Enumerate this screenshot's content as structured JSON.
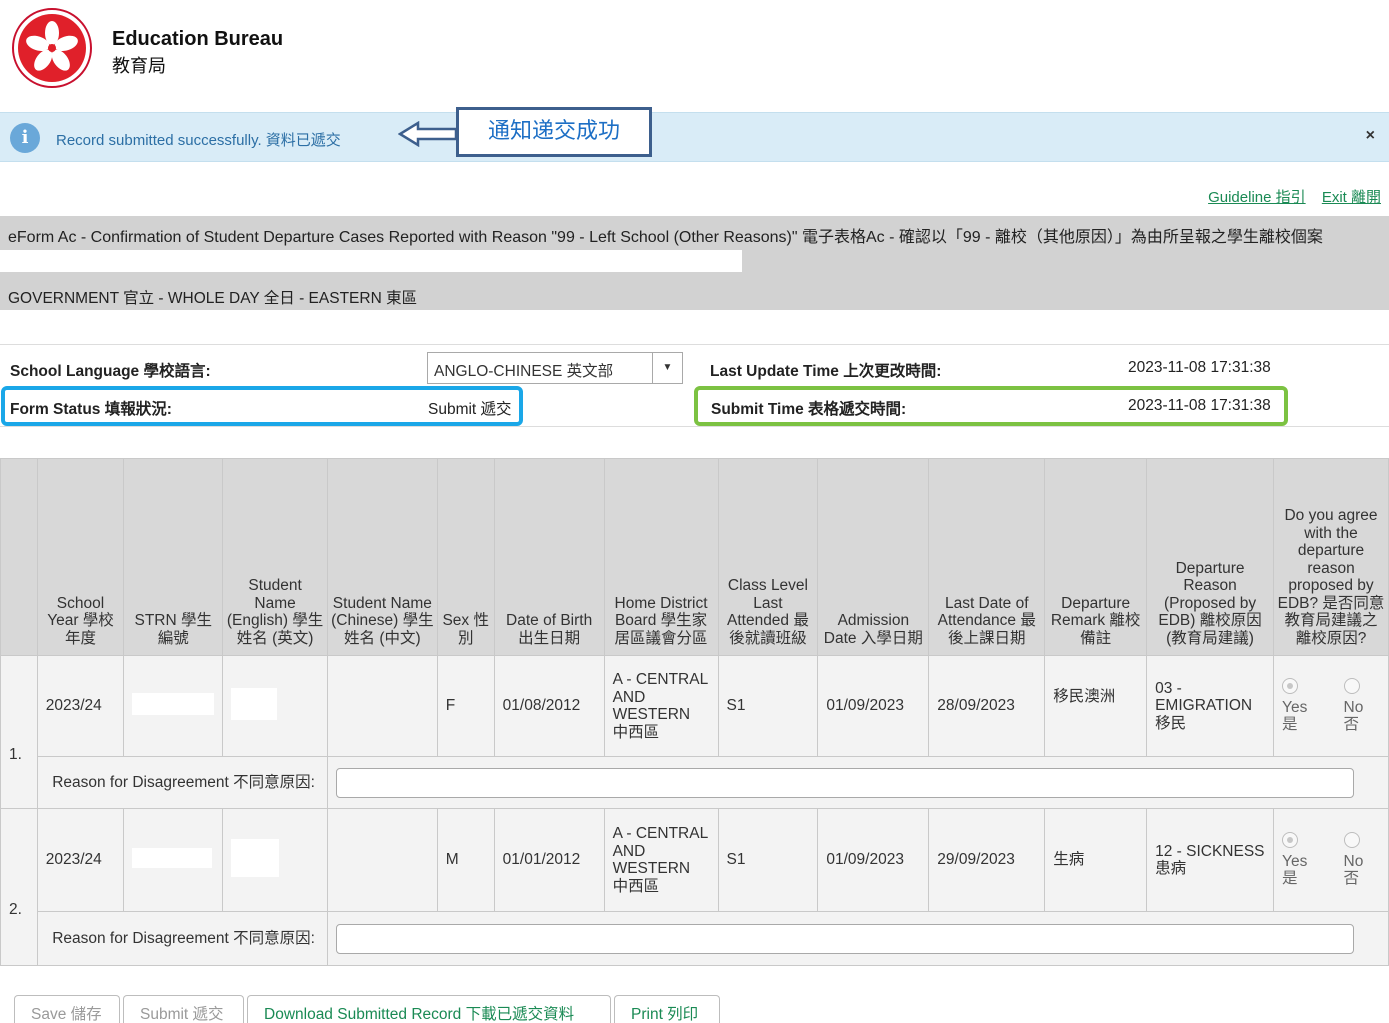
{
  "header": {
    "org_en": "Education Bureau",
    "org_zh": "教育局"
  },
  "notice": {
    "message": "Record submitted successfully. 資料已遞交",
    "close": "×",
    "callout": "通知递交成功"
  },
  "links": {
    "guideline": "Guideline 指引",
    "exit": "Exit 離開"
  },
  "form": {
    "title": "eForm Ac - Confirmation of Student Departure Cases Reported with Reason \"99 - Left School (Other Reasons)\" 電子表格Ac - 確認以「99 - 離校（其他原因）」為由所呈報之學生離校個案",
    "school_info": "GOVERNMENT 官立 - WHOLE DAY 全日 - EASTERN 東區"
  },
  "info": {
    "school_language_label": "School Language 學校語言:",
    "school_language_value": "ANGLO-CHINESE 英文部",
    "last_update_label": "Last Update Time 上次更改時間:",
    "last_update_value": "2023-11-08 17:31:38",
    "form_status_label": "Form Status 填報狀況:",
    "form_status_value": "Submit 遞交",
    "submit_time_label": "Submit Time 表格遞交時間:",
    "submit_time_value": "2023-11-08 17:31:38"
  },
  "table": {
    "headers": {
      "school_year": "School Year 學校年度",
      "strn": "STRN 學生編號",
      "name_en": "Student Name (English) 學生姓名 (英文)",
      "name_zh": "Student Name (Chinese) 學生姓名 (中文)",
      "sex": "Sex 性別",
      "dob": "Date of Birth 出生日期",
      "district": "Home District Board 學生家居區議會分區",
      "class_level": "Class Level Last Attended 最後就讀班級",
      "admission": "Admission Date 入學日期",
      "last_date": "Last Date of Attendance 最後上課日期",
      "remark": "Departure Remark 離校備註",
      "reason": "Departure Reason (Proposed by EDB) 離校原因 (教育局建議)",
      "agree": "Do you agree with the departure reason proposed by EDB? 是否同意教育局建議之離校原因?"
    },
    "rows": [
      {
        "index": "1.",
        "school_year": "2023/24",
        "sex": "F",
        "dob": "01/08/2012",
        "district": "A - CENTRAL AND WESTERN 中西區",
        "class_level": "S1",
        "admission": "01/09/2023",
        "last_date": "28/09/2023",
        "remark": "移民澳洲",
        "reason": "03 - EMIGRATION 移民",
        "yes": "Yes 是",
        "no": "No 否"
      },
      {
        "index": "2.",
        "school_year": "2023/24",
        "sex": "M",
        "dob": "01/01/2012",
        "district": "A - CENTRAL AND WESTERN 中西區",
        "class_level": "S1",
        "admission": "01/09/2023",
        "last_date": "29/09/2023",
        "remark": "生病",
        "reason": "12 - SICKNESS 患病",
        "yes": "Yes 是",
        "no": "No 否"
      }
    ],
    "disagree_label": "Reason for Disagreement 不同意原因:"
  },
  "buttons": {
    "save": "Save 儲存",
    "submit": "Submit 遞交",
    "download": "Download Submitted Record 下載已遞交資料",
    "print": "Print 列印"
  },
  "colors": {
    "notice_bg": "#d9ecf7",
    "link_green": "#1a8a54",
    "highlight_blue": "#1aa7e8",
    "highlight_green": "#7cc242",
    "title_gray": "#d2d2d2"
  }
}
